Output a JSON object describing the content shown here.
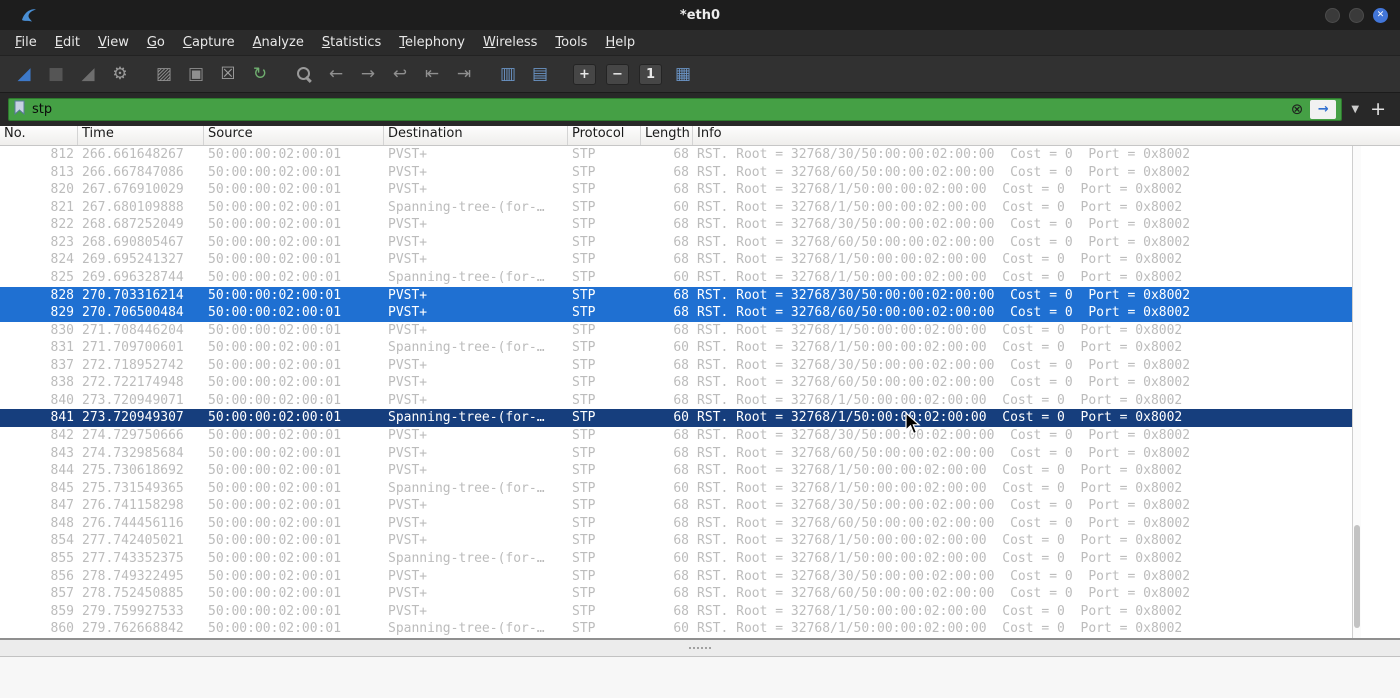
{
  "window": {
    "title": "*eth0",
    "close_glyph": "✕"
  },
  "menu": {
    "items": [
      "File",
      "Edit",
      "View",
      "Go",
      "Capture",
      "Analyze",
      "Statistics",
      "Telephony",
      "Wireless",
      "Tools",
      "Help"
    ]
  },
  "toolbar": {
    "items": [
      {
        "name": "start-capture-icon",
        "glyph": "◢",
        "color": "#3d79c9"
      },
      {
        "name": "stop-capture-icon",
        "glyph": "■",
        "color": "#555555"
      },
      {
        "name": "restart-capture-icon",
        "glyph": "◢",
        "color": "#6e6e6e"
      },
      {
        "name": "capture-options-icon",
        "glyph": "⚙",
        "color": "#9a9a9a",
        "sep_after": true
      },
      {
        "name": "open-file-icon",
        "glyph": "▨",
        "color": "#8f8f8f"
      },
      {
        "name": "save-file-icon",
        "glyph": "▣",
        "color": "#8f8f8f"
      },
      {
        "name": "close-file-icon",
        "glyph": "☒",
        "color": "#9f9f9f"
      },
      {
        "name": "reload-file-icon",
        "glyph": "↻",
        "color": "#6fae6f",
        "sep_after": true
      },
      {
        "name": "find-packet-icon",
        "glyph": "",
        "cls": "find"
      },
      {
        "name": "go-back-icon",
        "glyph": "←",
        "color": "#8f8f8f"
      },
      {
        "name": "go-forward-icon",
        "glyph": "→",
        "color": "#8f8f8f"
      },
      {
        "name": "go-to-packet-icon",
        "glyph": "↩",
        "color": "#8f8f8f"
      },
      {
        "name": "go-first-packet-icon",
        "glyph": "⇤",
        "color": "#8f8f8f"
      },
      {
        "name": "go-last-packet-icon",
        "glyph": "⇥",
        "color": "#8f8f8f",
        "sep_after": true
      },
      {
        "name": "auto-scroll-icon",
        "glyph": "▥",
        "color": "#6a93c4"
      },
      {
        "name": "colorize-icon",
        "glyph": "▤",
        "color": "#6a93c4",
        "sep_after": true
      },
      {
        "name": "zoom-in-icon",
        "glyph": "+",
        "cls": "sq"
      },
      {
        "name": "zoom-out-icon",
        "glyph": "−",
        "cls": "sq"
      },
      {
        "name": "zoom-original-icon",
        "glyph": "1",
        "cls": "sq"
      },
      {
        "name": "resize-columns-icon",
        "glyph": "▦",
        "color": "#6a93c4"
      }
    ]
  },
  "filter": {
    "value": "stp",
    "clear_glyph": "⊗",
    "apply_glyph": "→",
    "dropdown_glyph": "▼",
    "add_label": "+"
  },
  "packet_list": {
    "columns": [
      "No.",
      "Time",
      "Source",
      "Destination",
      "Protocol",
      "Length",
      "Info"
    ],
    "rows": [
      [
        "812",
        "266.661648267",
        "50:00:00:02:00:01",
        "PVST+",
        "STP",
        "68",
        "RST. Root = 32768/30/50:00:00:02:00:00  Cost = 0  Port = 0x8002",
        "normal"
      ],
      [
        "813",
        "266.667847086",
        "50:00:00:02:00:01",
        "PVST+",
        "STP",
        "68",
        "RST. Root = 32768/60/50:00:00:02:00:00  Cost = 0  Port = 0x8002",
        "normal"
      ],
      [
        "820",
        "267.676910029",
        "50:00:00:02:00:01",
        "PVST+",
        "STP",
        "68",
        "RST. Root = 32768/1/50:00:00:02:00:00  Cost = 0  Port = 0x8002",
        "normal"
      ],
      [
        "821",
        "267.680109888",
        "50:00:00:02:00:01",
        "Spanning-tree-(for-…",
        "STP",
        "60",
        "RST. Root = 32768/1/50:00:00:02:00:00  Cost = 0  Port = 0x8002",
        "normal"
      ],
      [
        "822",
        "268.687252049",
        "50:00:00:02:00:01",
        "PVST+",
        "STP",
        "68",
        "RST. Root = 32768/30/50:00:00:02:00:00  Cost = 0  Port = 0x8002",
        "normal"
      ],
      [
        "823",
        "268.690805467",
        "50:00:00:02:00:01",
        "PVST+",
        "STP",
        "68",
        "RST. Root = 32768/60/50:00:00:02:00:00  Cost = 0  Port = 0x8002",
        "normal"
      ],
      [
        "824",
        "269.695241327",
        "50:00:00:02:00:01",
        "PVST+",
        "STP",
        "68",
        "RST. Root = 32768/1/50:00:00:02:00:00  Cost = 0  Port = 0x8002",
        "normal"
      ],
      [
        "825",
        "269.696328744",
        "50:00:00:02:00:01",
        "Spanning-tree-(for-…",
        "STP",
        "60",
        "RST. Root = 32768/1/50:00:00:02:00:00  Cost = 0  Port = 0x8002",
        "normal"
      ],
      [
        "828",
        "270.703316214",
        "50:00:00:02:00:01",
        "PVST+",
        "STP",
        "68",
        "RST. Root = 32768/30/50:00:00:02:00:00  Cost = 0  Port = 0x8002",
        "selected"
      ],
      [
        "829",
        "270.706500484",
        "50:00:00:02:00:01",
        "PVST+",
        "STP",
        "68",
        "RST. Root = 32768/60/50:00:00:02:00:00  Cost = 0  Port = 0x8002",
        "selected"
      ],
      [
        "830",
        "271.708446204",
        "50:00:00:02:00:01",
        "PVST+",
        "STP",
        "68",
        "RST. Root = 32768/1/50:00:00:02:00:00  Cost = 0  Port = 0x8002",
        "normal"
      ],
      [
        "831",
        "271.709700601",
        "50:00:00:02:00:01",
        "Spanning-tree-(for-…",
        "STP",
        "60",
        "RST. Root = 32768/1/50:00:00:02:00:00  Cost = 0  Port = 0x8002",
        "normal"
      ],
      [
        "837",
        "272.718952742",
        "50:00:00:02:00:01",
        "PVST+",
        "STP",
        "68",
        "RST. Root = 32768/30/50:00:00:02:00:00  Cost = 0  Port = 0x8002",
        "normal"
      ],
      [
        "838",
        "272.722174948",
        "50:00:00:02:00:01",
        "PVST+",
        "STP",
        "68",
        "RST. Root = 32768/60/50:00:00:02:00:00  Cost = 0  Port = 0x8002",
        "normal"
      ],
      [
        "840",
        "273.720949071",
        "50:00:00:02:00:01",
        "PVST+",
        "STP",
        "68",
        "RST. Root = 32768/1/50:00:00:02:00:00  Cost = 0  Port = 0x8002",
        "normal"
      ],
      [
        "841",
        "273.720949307",
        "50:00:00:02:00:01",
        "Spanning-tree-(for-…",
        "STP",
        "60",
        "RST. Root = 32768/1/50:00:00:02:00:00  Cost = 0  Port = 0x8002",
        "focused"
      ],
      [
        "842",
        "274.729750666",
        "50:00:00:02:00:01",
        "PVST+",
        "STP",
        "68",
        "RST. Root = 32768/30/50:00:00:02:00:00  Cost = 0  Port = 0x8002",
        "normal"
      ],
      [
        "843",
        "274.732985684",
        "50:00:00:02:00:01",
        "PVST+",
        "STP",
        "68",
        "RST. Root = 32768/60/50:00:00:02:00:00  Cost = 0  Port = 0x8002",
        "normal"
      ],
      [
        "844",
        "275.730618692",
        "50:00:00:02:00:01",
        "PVST+",
        "STP",
        "68",
        "RST. Root = 32768/1/50:00:00:02:00:00  Cost = 0  Port = 0x8002",
        "normal"
      ],
      [
        "845",
        "275.731549365",
        "50:00:00:02:00:01",
        "Spanning-tree-(for-…",
        "STP",
        "60",
        "RST. Root = 32768/1/50:00:00:02:00:00  Cost = 0  Port = 0x8002",
        "normal"
      ],
      [
        "847",
        "276.741158298",
        "50:00:00:02:00:01",
        "PVST+",
        "STP",
        "68",
        "RST. Root = 32768/30/50:00:00:02:00:00  Cost = 0  Port = 0x8002",
        "normal"
      ],
      [
        "848",
        "276.744456116",
        "50:00:00:02:00:01",
        "PVST+",
        "STP",
        "68",
        "RST. Root = 32768/60/50:00:00:02:00:00  Cost = 0  Port = 0x8002",
        "normal"
      ],
      [
        "854",
        "277.742405021",
        "50:00:00:02:00:01",
        "PVST+",
        "STP",
        "68",
        "RST. Root = 32768/1/50:00:00:02:00:00  Cost = 0  Port = 0x8002",
        "normal"
      ],
      [
        "855",
        "277.743352375",
        "50:00:00:02:00:01",
        "Spanning-tree-(for-…",
        "STP",
        "60",
        "RST. Root = 32768/1/50:00:00:02:00:00  Cost = 0  Port = 0x8002",
        "normal"
      ],
      [
        "856",
        "278.749322495",
        "50:00:00:02:00:01",
        "PVST+",
        "STP",
        "68",
        "RST. Root = 32768/30/50:00:00:02:00:00  Cost = 0  Port = 0x8002",
        "normal"
      ],
      [
        "857",
        "278.752450885",
        "50:00:00:02:00:01",
        "PVST+",
        "STP",
        "68",
        "RST. Root = 32768/60/50:00:00:02:00:00  Cost = 0  Port = 0x8002",
        "normal"
      ],
      [
        "859",
        "279.759927533",
        "50:00:00:02:00:01",
        "PVST+",
        "STP",
        "68",
        "RST. Root = 32768/1/50:00:00:02:00:00  Cost = 0  Port = 0x8002",
        "normal"
      ],
      [
        "860",
        "279.762668842",
        "50:00:00:02:00:01",
        "Spanning-tree-(for-…",
        "STP",
        "60",
        "RST. Root = 32768/1/50:00:00:02:00:00  Cost = 0  Port = 0x8002",
        "normal"
      ]
    ]
  },
  "colors": {
    "sel_light": "#1f70d2",
    "sel_dark": "#163e7d",
    "filter_valid": "#45a045",
    "row_text": "#bcbcbc",
    "close_btn": "#4276d9"
  }
}
